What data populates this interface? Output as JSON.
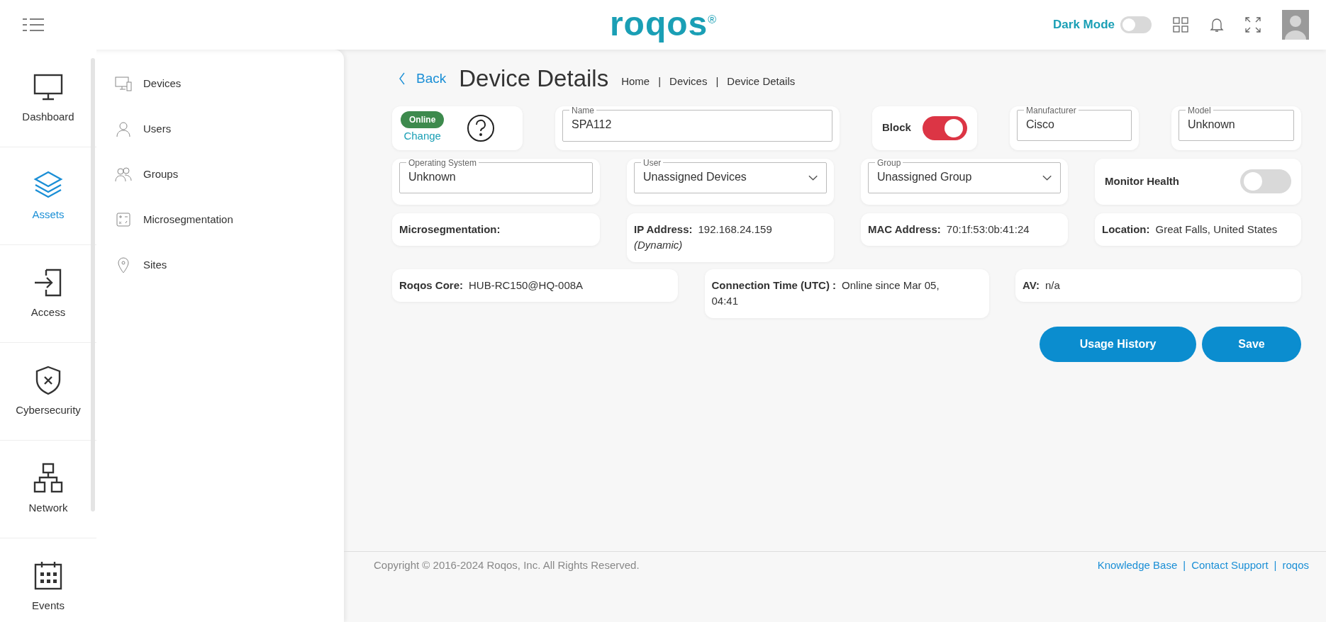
{
  "header": {
    "logo": "roqos",
    "logo_mark": "®",
    "dark_mode": {
      "label": "Dark Mode",
      "on": false
    }
  },
  "rail": [
    {
      "label": "Dashboard",
      "selected": false
    },
    {
      "label": "Assets",
      "selected": true
    },
    {
      "label": "Access",
      "selected": false
    },
    {
      "label": "Cybersecurity",
      "selected": false
    },
    {
      "label": "Network",
      "selected": false
    },
    {
      "label": "Events",
      "selected": false
    }
  ],
  "submenu": [
    "Devices",
    "Users",
    "Groups",
    "Microsegmentation",
    "Sites"
  ],
  "page": {
    "back": "Back",
    "title": "Device Details",
    "breadcrumb": [
      "Home",
      "Devices",
      "Device Details"
    ],
    "separator": "|"
  },
  "status": {
    "badge": "Online",
    "link": "Change"
  },
  "name": {
    "label": "Name",
    "value": "SPA112"
  },
  "block": {
    "label": "Block",
    "on": true
  },
  "manufacturer": {
    "label": "Manufacturer",
    "value": "Cisco"
  },
  "model": {
    "label": "Model",
    "value": "Unknown"
  },
  "operating_system": {
    "label": "Operating System",
    "value": "Unknown"
  },
  "user": {
    "label": "User",
    "value": "Unassigned Devices"
  },
  "group": {
    "label": "Group",
    "value": "Unassigned Group"
  },
  "monitor_health": {
    "label": "Monitor Health",
    "on": false
  },
  "info": [
    {
      "label": "Microsegmentation:"
    },
    {
      "label": "IP Address:",
      "value": "192.168.24.159",
      "note": "(Dynamic)"
    },
    {
      "label": "MAC Address:",
      "value": "70:1f:53:0b:41:24"
    },
    {
      "label": "Location:",
      "value": "Great Falls, United States"
    },
    {
      "label": "Roqos Core:",
      "value": "HUB-RC150@HQ-008A"
    },
    {
      "label": "Connection Time (UTC) :",
      "value": "Online since Mar 05, 04:41"
    },
    {
      "label": "AV:",
      "value": "n/a"
    }
  ],
  "buttons": [
    "Usage History",
    "Save"
  ],
  "footer": {
    "copyright": "Copyright © 2016-2024 Roqos, Inc. All Rights Reserved.",
    "links": [
      "Knowledge Base",
      "Contact Support",
      "roqos"
    ],
    "separator": "|"
  }
}
